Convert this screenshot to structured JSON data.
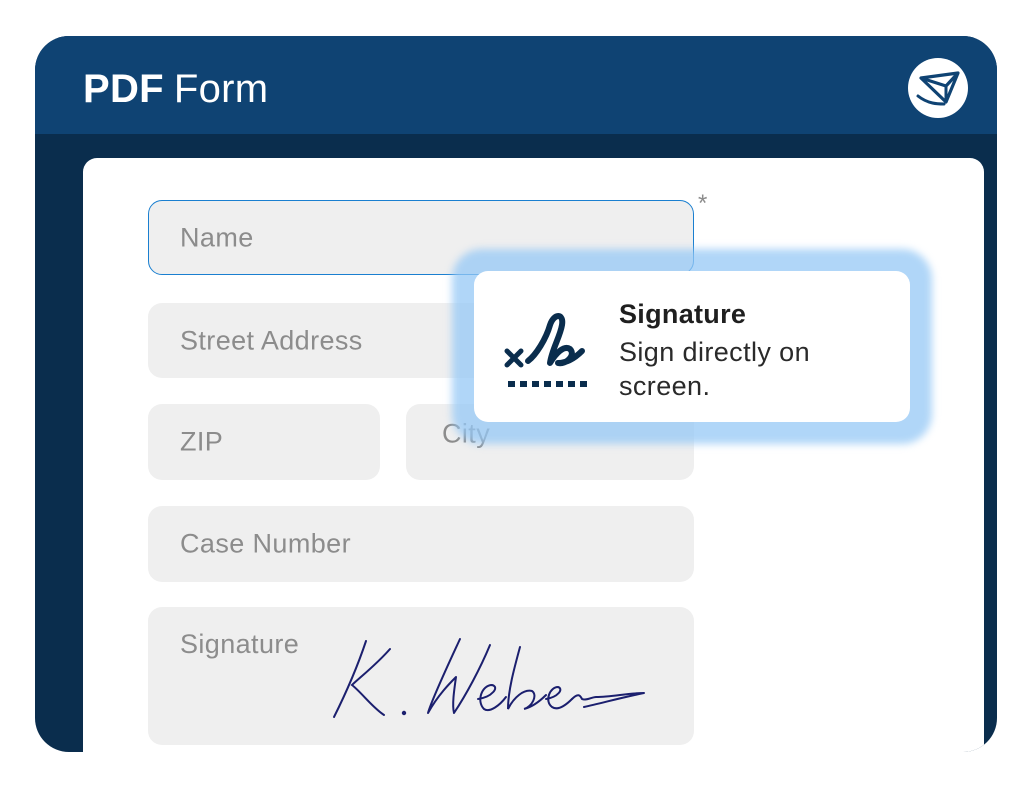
{
  "window": {
    "title_bold": "PDF",
    "title_light": "Form",
    "logo_icon": "paper-plane-logo-icon"
  },
  "form": {
    "required_marker": "*",
    "fields": {
      "name": "Name",
      "street": "Street Address",
      "zip": "ZIP",
      "city": "City",
      "case_number": "Case Number",
      "signature": "Signature"
    },
    "signature_value": "K. Weber"
  },
  "tooltip": {
    "icon": "signature-icon",
    "title": "Signature",
    "description": "Sign directly on screen."
  },
  "colors": {
    "titlebar": "#0f4373",
    "frame": "#0a2d4d",
    "field_bg": "#efefef",
    "active_border": "#1a7fd0",
    "highlight": "#96c8f5",
    "ink": "#1b1f6e"
  }
}
